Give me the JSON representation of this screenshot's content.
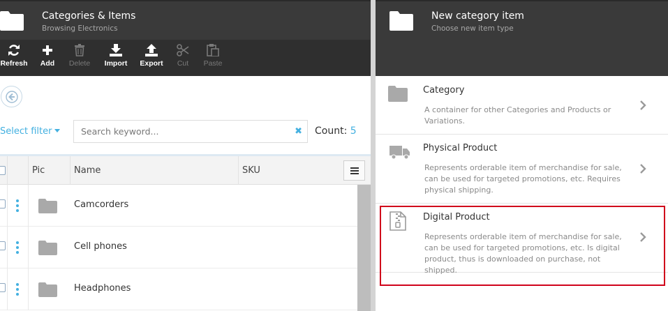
{
  "left_blade": {
    "title": "Categories & Items",
    "subtitle": "Browsing Electronics",
    "toolbar": [
      {
        "label": "Refresh",
        "icon": "refresh-icon",
        "enabled": true
      },
      {
        "label": "Add",
        "icon": "plus-icon",
        "enabled": true
      },
      {
        "label": "Delete",
        "icon": "trash-icon",
        "enabled": false
      },
      {
        "label": "Import",
        "icon": "download-icon",
        "enabled": true
      },
      {
        "label": "Export",
        "icon": "upload-icon",
        "enabled": true
      },
      {
        "label": "Cut",
        "icon": "scissors-icon",
        "enabled": false
      },
      {
        "label": "Paste",
        "icon": "clipboard-icon",
        "enabled": false
      }
    ],
    "filter_label": "Select filter",
    "search": {
      "placeholder": "Search keyword...",
      "value": ""
    },
    "count_label": "Count:",
    "count_value": "5",
    "columns": [
      "Pic",
      "Name",
      "SKU"
    ],
    "rows": [
      {
        "name": "Camcorders"
      },
      {
        "name": "Cell phones"
      },
      {
        "name": "Headphones"
      }
    ]
  },
  "right_blade": {
    "title": "New category item",
    "subtitle": "Choose new item type",
    "types": [
      {
        "title": "Category",
        "icon": "folder-icon",
        "description": "A container for other Categories and Products or Variations."
      },
      {
        "title": "Physical Product",
        "icon": "truck-icon",
        "description": "Represents orderable item of merchandise for sale, can be used for targeted promotions, etc. Requires physical shipping."
      },
      {
        "title": "Digital Product",
        "icon": "zip-file-icon",
        "description": "Represents orderable item of merchandise for sale, can be used for targeted promotions, etc. Is digital product, thus is downloaded on purchase, not shipped."
      }
    ]
  },
  "colors": {
    "header_bg": "#3a3a3a",
    "toolbar_bg": "#2f2f2f",
    "accent": "#43b0e0",
    "highlight": "#d0021b"
  }
}
